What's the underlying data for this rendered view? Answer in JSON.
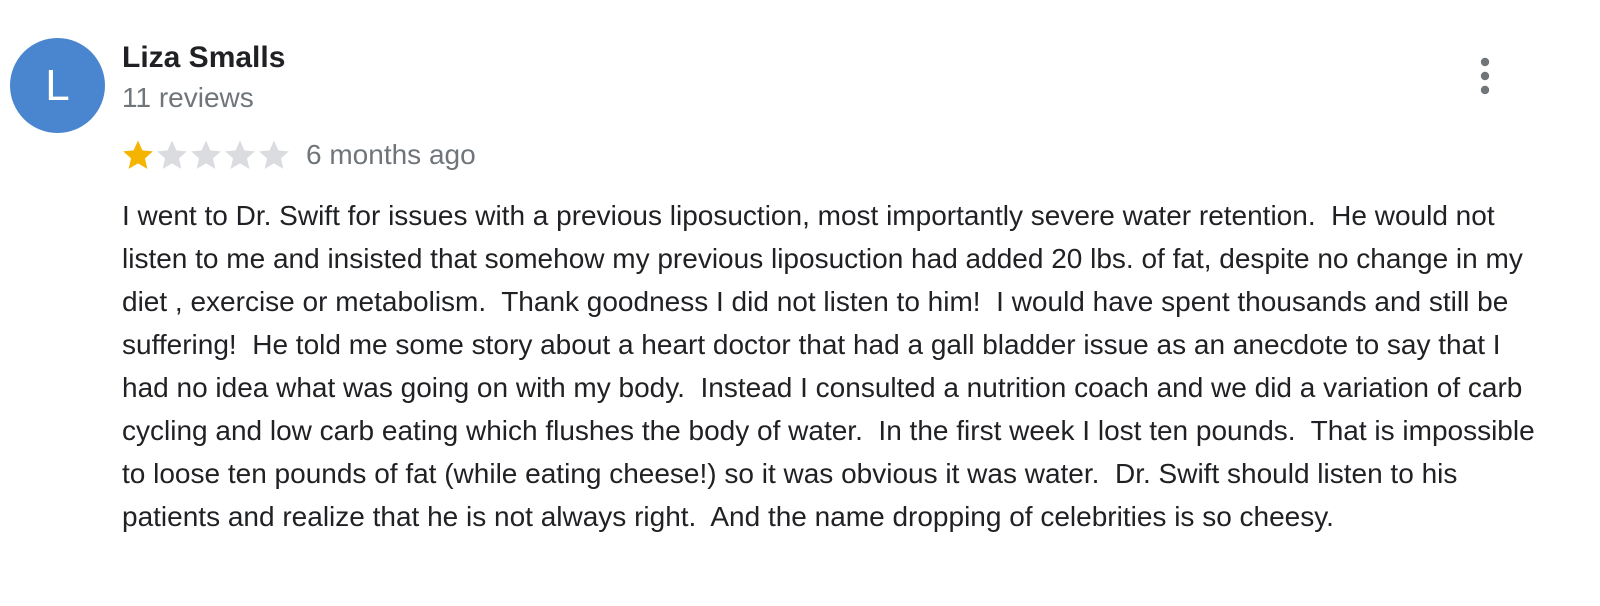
{
  "review": {
    "author": {
      "initial": "L",
      "name": "Liza Smalls",
      "review_count": "11 reviews",
      "avatar_color": "#4a86cf"
    },
    "menu_icon": "more-vert-icon",
    "rating": {
      "value": 1,
      "max": 5,
      "filled_color": "#f4b400",
      "empty_color": "#dadce0"
    },
    "date": "6 months ago",
    "text": "I went to Dr. Swift for issues with a previous liposuction, most importantly severe water retention.  He would not listen to me and insisted that somehow my previous liposuction had added 20 lbs. of fat, despite no change in my diet , exercise or metabolism.  Thank goodness I did not listen to him!  I would have spent thousands and still be suffering!  He told me some story about a heart doctor that had a gall bladder issue as an anecdote to say that I had no idea what was going on with my body.  Instead I consulted a nutrition coach and we did a variation of carb cycling and low carb eating which flushes the body of water.  In the first week I lost ten pounds.  That is impossible to loose ten pounds of fat (while eating cheese!) so it was obvious it was water.  Dr. Swift should listen to his patients and realize that he is not always right.  And the name dropping of celebrities is so cheesy."
  }
}
